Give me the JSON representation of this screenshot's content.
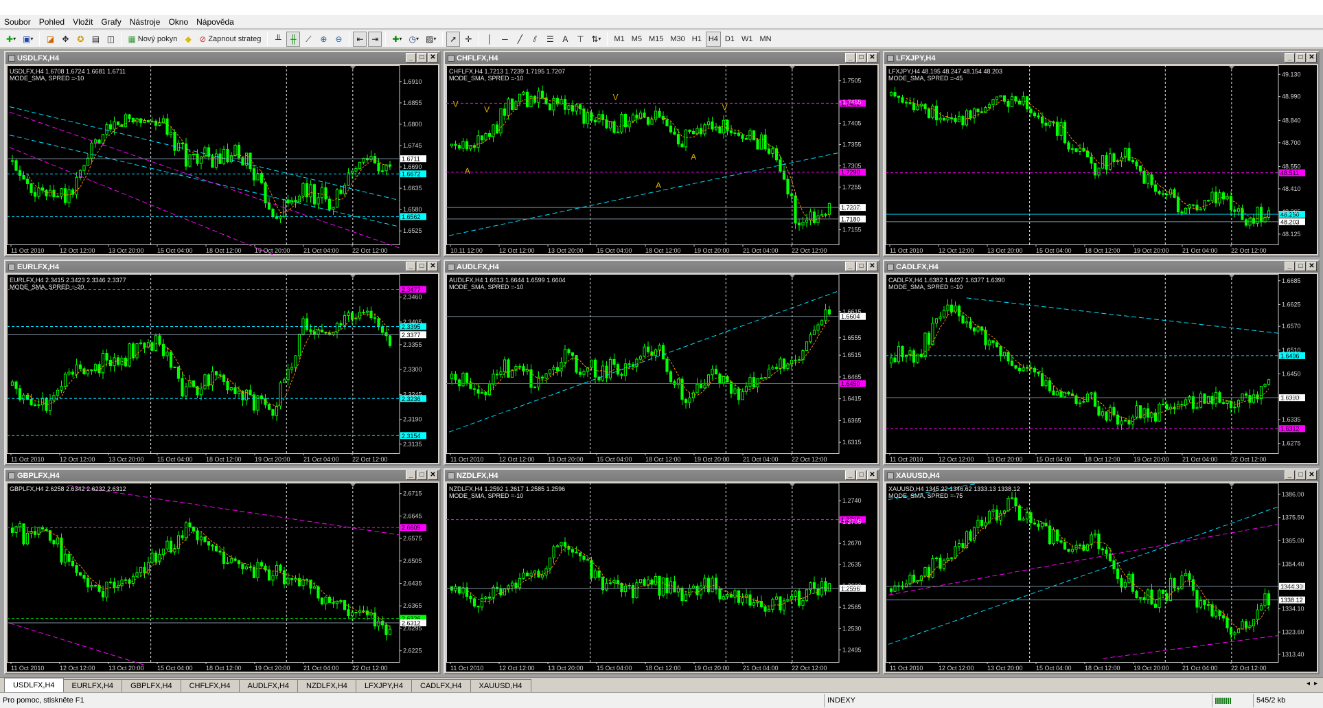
{
  "menu": [
    "Soubor",
    "Pohled",
    "Vložit",
    "Grafy",
    "Nástroje",
    "Okno",
    "Nápověda"
  ],
  "toolbar": {
    "new_order_label": "Nový pokyn",
    "strategy_label": "Zapnout strateg",
    "periods": [
      "M1",
      "M5",
      "M15",
      "M30",
      "H1",
      "H4",
      "D1",
      "W1",
      "MN"
    ],
    "active_period": "H4"
  },
  "colors": {
    "candle": "#00ff00",
    "ma": "#ff8c00",
    "hline_magenta": "#ff00ff",
    "hline_cyan": "#00ffff",
    "grid": "#ffffff",
    "price_line": "#8090a0"
  },
  "charts": [
    {
      "title": "USDLFX,H4",
      "info1": "USDLFX,H4  1.6708 1.6724 1.6681 1.6711",
      "info2": "MODE_SMA, SPRED =-10",
      "ymin": 1.649,
      "ymax": 1.6945,
      "ticks": [
        "1.6910",
        "1.6855",
        "1.6800",
        "1.6745",
        "1.6690",
        "1.6635",
        "1.6580",
        "1.6525"
      ],
      "hlines": [
        {
          "v": 1.6672,
          "color": "cyan",
          "label": "1.6672",
          "style": "dash"
        },
        {
          "v": 1.6562,
          "color": "cyan",
          "label": "1.6562",
          "style": "dash"
        }
      ],
      "price": {
        "v": 1.6711,
        "label": "1.6711"
      },
      "tls": [
        {
          "c": "cyan",
          "p": [
            0,
            0.62,
            1,
            0.1
          ]
        },
        {
          "c": "cyan",
          "p": [
            0,
            0.78,
            1,
            0.25
          ]
        },
        {
          "c": "magenta",
          "p": [
            0,
            0.75,
            1,
            -0.02
          ]
        },
        {
          "c": "magenta",
          "p": [
            0,
            0.55,
            1,
            -0.35
          ]
        }
      ],
      "trend": [
        0.45,
        0.3,
        0.28,
        0.6,
        0.72,
        0.7,
        0.5,
        0.47,
        0.5,
        0.15,
        0.3,
        0.25,
        0.48,
        0.45
      ],
      "time": [
        "11 Oct 2010",
        "12 Oct 12:00",
        "13 Oct 20:00",
        "15 Oct 04:00",
        "18 Oct 12:00",
        "19 Oct 20:00",
        "21 Oct 04:00",
        "22 Oct 12:00"
      ]
    },
    {
      "title": "CHFLFX,H4",
      "info1": "CHFLFX,H4  1.7213 1.7239 1.7195 1.7207",
      "info2": "MODE_SMA, SPRED =-10",
      "ymin": 1.712,
      "ymax": 1.7535,
      "ticks": [
        "1.7505",
        "1.7455",
        "1.7405",
        "1.7355",
        "1.7305",
        "1.7255",
        "1.7205",
        "1.7155"
      ],
      "hlines": [
        {
          "v": 1.7452,
          "color": "magenta",
          "label": "1.7452",
          "style": "dash"
        },
        {
          "v": 1.729,
          "color": "magenta",
          "label": "1.7290",
          "style": "dash"
        }
      ],
      "price": {
        "v": 1.7207,
        "label": "1.7207"
      },
      "price2": {
        "v": 1.718,
        "label": "1.7180"
      },
      "tls": [
        {
          "c": "cyan",
          "p": [
            0,
            0.05,
            1,
            0.52
          ]
        }
      ],
      "trend": [
        0.55,
        0.58,
        0.8,
        0.82,
        0.78,
        0.7,
        0.68,
        0.72,
        0.6,
        0.65,
        0.62,
        0.55,
        0.1,
        0.2
      ],
      "markers": [
        {
          "t": "V",
          "x": 0.01,
          "y": 0.78
        },
        {
          "t": "V",
          "x": 0.09,
          "y": 0.75
        },
        {
          "t": "A",
          "x": 0.04,
          "y": 0.4
        },
        {
          "t": "V",
          "x": 0.42,
          "y": 0.82
        },
        {
          "t": "A",
          "x": 0.53,
          "y": 0.32
        },
        {
          "t": "A",
          "x": 0.62,
          "y": 0.48
        },
        {
          "t": "V",
          "x": 0.7,
          "y": 0.76
        }
      ],
      "time": [
        "10.11 12:00",
        "12 Oct 12:00",
        "13 Oct 20:00",
        "15 Oct 04:00",
        "18 Oct 12:00",
        "19 Oct 20:00",
        "21 Oct 04:00",
        "22 Oct 12:00"
      ]
    },
    {
      "title": "LFXJPY,H4",
      "info1": "LFXJPY,H4  48.195 48.247 48.154 48.203",
      "info2": "MODE_SMA, SPRED =-45",
      "ymin": 48.06,
      "ymax": 49.17,
      "ticks": [
        "49.130",
        "48.990",
        "48.840",
        "48.700",
        "48.550",
        "48.410",
        "48.265",
        "48.125"
      ],
      "hlines": [
        {
          "v": 48.511,
          "color": "magenta",
          "label": "48.511",
          "style": "dash"
        },
        {
          "v": 48.25,
          "color": "cyan",
          "label": "48.250",
          "style": "solid"
        }
      ],
      "price": {
        "v": 48.203,
        "label": "48.203"
      },
      "tls": [],
      "trend": [
        0.85,
        0.8,
        0.7,
        0.78,
        0.82,
        0.75,
        0.6,
        0.45,
        0.5,
        0.35,
        0.2,
        0.28,
        0.18,
        0.15
      ],
      "time": [
        "11 Oct 2010",
        "12 Oct 12:00",
        "13 Oct 20:00",
        "15 Oct 04:00",
        "18 Oct 12:00",
        "19 Oct 20:00",
        "21 Oct 04:00",
        "22 Oct 12:00"
      ]
    },
    {
      "title": "EURLFX,H4",
      "info1": "EURLFX,H4  2.3415 2.3423 2.3346 2.3377",
      "info2": "MODE_SMA, SPRED =-20",
      "ymin": 2.3115,
      "ymax": 2.3505,
      "ticks": [
        "2.3460",
        "2.3405",
        "2.3355",
        "2.3300",
        "2.3245",
        "2.3190",
        "2.3135"
      ],
      "hlines": [
        {
          "v": 2.3477,
          "color": "magenta",
          "label": "2.3477",
          "style": "dash"
        },
        {
          "v": 2.3395,
          "color": "cyan",
          "label": "2.3395",
          "style": "dash"
        },
        {
          "v": 2.3236,
          "color": "cyan",
          "label": "2.3236",
          "style": "dash"
        },
        {
          "v": 2.3154,
          "color": "cyan",
          "label": "2.3154",
          "style": "dash"
        }
      ],
      "price": {
        "v": 2.3377,
        "label": "2.3377"
      },
      "tls": [],
      "trend": [
        0.4,
        0.25,
        0.45,
        0.5,
        0.55,
        0.62,
        0.35,
        0.45,
        0.3,
        0.25,
        0.7,
        0.68,
        0.85,
        0.62
      ],
      "time": [
        "11 Oct 2010",
        "12 Oct 12:00",
        "13 Oct 20:00",
        "15 Oct 04:00",
        "18 Oct 12:00",
        "19 Oct 20:00",
        "21 Oct 04:00",
        "22 Oct 12:00"
      ]
    },
    {
      "title": "AUDLFX,H4",
      "info1": "AUDLFX,H4  1.6613 1.6644 1.6599 1.6604",
      "info2": "MODE_SMA, SPRED =-10",
      "ymin": 1.629,
      "ymax": 1.6695,
      "ticks": [
        "1.6615",
        "1.6555",
        "1.6515",
        "1.6465",
        "1.6415",
        "1.6365",
        "1.6315"
      ],
      "hlines": [
        {
          "v": 1.645,
          "color": "magenta",
          "label": "1.6450",
          "style": "solid"
        }
      ],
      "price": {
        "v": 1.6604,
        "label": "1.6604"
      },
      "tls": [
        {
          "c": "cyan",
          "p": [
            0,
            0.12,
            1,
            0.92
          ]
        }
      ],
      "trend": [
        0.45,
        0.38,
        0.5,
        0.4,
        0.55,
        0.45,
        0.5,
        0.6,
        0.3,
        0.45,
        0.35,
        0.48,
        0.55,
        0.85
      ],
      "time": [
        "11 Oct 2010",
        "12 Oct 12:00",
        "13 Oct 20:00",
        "15 Oct 04:00",
        "18 Oct 12:00",
        "19 Oct 20:00",
        "21 Oct 04:00",
        "22 Oct 12:00"
      ]
    },
    {
      "title": "CADLFX,H4",
      "info1": "CADLFX,H4  1.6382 1.6427 1.6377 1.6390",
      "info2": "MODE_SMA, SPRED =-10",
      "ymin": 1.625,
      "ymax": 1.6695,
      "ticks": [
        "1.6685",
        "1.6625",
        "1.6570",
        "1.6510",
        "1.6450",
        "1.6390",
        "1.6335",
        "1.6275"
      ],
      "hlines": [
        {
          "v": 1.6496,
          "color": "cyan",
          "label": "1.6496",
          "style": "dash"
        },
        {
          "v": 1.6312,
          "color": "magenta",
          "label": "1.6312",
          "style": "dash"
        }
      ],
      "price": {
        "v": 1.639,
        "label": "1.6390"
      },
      "tls": [
        {
          "c": "cyan",
          "p": [
            0.2,
            0.88,
            1,
            0.68
          ]
        }
      ],
      "trend": [
        0.55,
        0.58,
        0.85,
        0.7,
        0.55,
        0.4,
        0.35,
        0.28,
        0.2,
        0.22,
        0.28,
        0.3,
        0.32,
        0.38
      ],
      "time": [
        "11 Oct 2010",
        "12 Oct 12:00",
        "13 Oct 20:00",
        "15 Oct 04:00",
        "18 Oct 12:00",
        "19 Oct 20:00",
        "21 Oct 04:00",
        "22 Oct 12:00"
      ]
    },
    {
      "title": "GBPLFX,H4",
      "info1": "GBPLFX,H4  2.6258 2.6342 2.6232 2.6312",
      "info2": "",
      "ymin": 2.619,
      "ymax": 2.674,
      "ticks": [
        "2.6715",
        "2.6645",
        "2.6575",
        "2.6505",
        "2.6435",
        "2.6365",
        "2.6295",
        "2.6225"
      ],
      "hlines": [
        {
          "v": 2.6609,
          "color": "magenta",
          "label": "2.6609",
          "style": "dash"
        },
        {
          "v": 2.6326,
          "color": "green",
          "label": "2.6326",
          "style": "dash"
        }
      ],
      "price": {
        "v": 2.6312,
        "label": "2.6312"
      },
      "tls": [
        {
          "c": "magenta",
          "p": [
            0.15,
            1.0,
            1,
            0.72
          ]
        },
        {
          "c": "magenta",
          "p": [
            0,
            0.22,
            0.35,
            -0.02
          ]
        }
      ],
      "trend": [
        0.72,
        0.75,
        0.55,
        0.4,
        0.45,
        0.6,
        0.75,
        0.65,
        0.55,
        0.5,
        0.45,
        0.35,
        0.28,
        0.2
      ],
      "time": [
        "11 Oct 2010",
        "12 Oct 12:00",
        "13 Oct 20:00",
        "15 Oct 04:00",
        "18 Oct 12:00",
        "19 Oct 20:00",
        "21 Oct 04:00",
        "22 Oct 12:00"
      ]
    },
    {
      "title": "NZDLFX,H4",
      "info1": "NZDLFX,H4  1.2592 1.2617 1.2585 1.2596",
      "info2": "MODE_SMA, SPRED =-10",
      "ymin": 1.2475,
      "ymax": 1.2765,
      "ticks": [
        "1.2740",
        "1.2705",
        "1.2670",
        "1.2635",
        "1.2600",
        "1.2565",
        "1.2530",
        "1.2495"
      ],
      "hlines": [
        {
          "v": 1.2709,
          "color": "magenta",
          "label": "1.2709",
          "style": "dash"
        }
      ],
      "price": {
        "v": 1.2596,
        "label": "1.2596"
      },
      "tls": [],
      "trend": [
        0.4,
        0.35,
        0.45,
        0.5,
        0.7,
        0.45,
        0.4,
        0.45,
        0.38,
        0.42,
        0.35,
        0.3,
        0.38,
        0.45
      ],
      "time": [
        "11 Oct 2010",
        "12 Oct 12:00",
        "13 Oct 20:00",
        "15 Oct 04:00",
        "18 Oct 12:00",
        "19 Oct 20:00",
        "21 Oct 04:00",
        "22 Oct 12:00"
      ]
    },
    {
      "title": "XAUUSD,H4",
      "info1": "XAUUSD,H4  1345.22 1346.62 1333.13 1338.12",
      "info2": "MODE_SMA, SPRED =-75",
      "ymin": 1310.0,
      "ymax": 1390.0,
      "ticks": [
        "1386.00",
        "1375.50",
        "1365.00",
        "1354.40",
        "1344.30",
        "1334.10",
        "1323.60",
        "1313.40"
      ],
      "hlines": [],
      "price": {
        "v": 1338.12,
        "label": "1338.12"
      },
      "price2": {
        "v": 1344.3,
        "label": "1344.30"
      },
      "tls": [
        {
          "c": "cyan",
          "p": [
            0,
            0.92,
            0.35,
            1.06
          ]
        },
        {
          "c": "cyan",
          "p": [
            0,
            0.1,
            1,
            0.88
          ]
        },
        {
          "c": "magenta",
          "p": [
            0,
            0.38,
            1,
            0.78
          ]
        },
        {
          "c": "magenta",
          "p": [
            0.55,
            0.02,
            1,
            0.15
          ]
        }
      ],
      "trend": [
        0.4,
        0.48,
        0.6,
        0.75,
        0.88,
        0.8,
        0.65,
        0.7,
        0.45,
        0.35,
        0.48,
        0.3,
        0.15,
        0.38
      ],
      "time": [
        "11 Oct 2010",
        "12 Oct 12:00",
        "13 Oct 20:00",
        "15 Oct 04:00",
        "18 Oct 12:00",
        "19 Oct 20:00",
        "21 Oct 04:00",
        "22 Oct 12:00"
      ]
    }
  ],
  "tabs": [
    "USDLFX,H4",
    "EURLFX,H4",
    "GBPLFX,H4",
    "CHFLFX,H4",
    "AUDLFX,H4",
    "NZDLFX,H4",
    "LFXJPY,H4",
    "CADLFX,H4",
    "XAUUSD,H4"
  ],
  "active_tab": "USDLFX,H4",
  "status": {
    "help": "Pro pomoc, stiskněte F1",
    "profile": "INDEXY",
    "traffic": "545/2 kb"
  }
}
